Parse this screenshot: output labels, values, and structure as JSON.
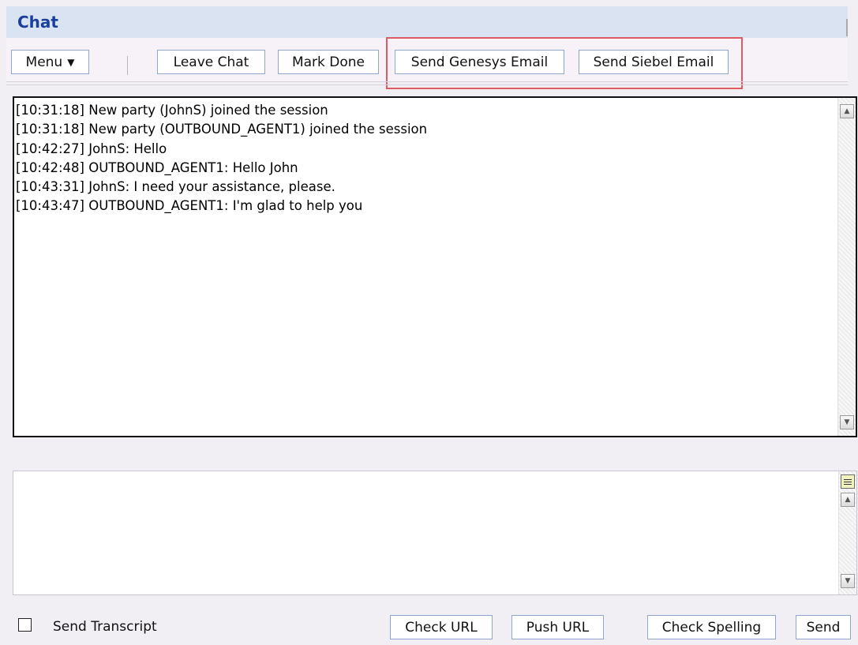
{
  "window": {
    "title": "Chat"
  },
  "toolbar": {
    "menu_label": "Menu",
    "menu_caret_icon": "caret-down-icon",
    "leave_chat_label": "Leave Chat",
    "mark_done_label": "Mark Done",
    "send_genesys_email_label": "Send Genesys Email",
    "send_siebel_email_label": "Send Siebel Email",
    "highlight_color": "#e05a64"
  },
  "transcript": {
    "lines": [
      "[10:31:18] New party (JohnS) joined the session",
      "[10:31:18] New party (OUTBOUND_AGENT1) joined the session",
      "[10:42:27] JohnS: Hello",
      "[10:42:48] OUTBOUND_AGENT1: Hello John",
      "[10:43:31] JohnS: I need your assistance, please.",
      "[10:43:47] OUTBOUND_AGENT1: I'm glad to help you"
    ],
    "scroll_up_icon": "scroll-up-icon",
    "scroll_down_icon": "scroll-down-icon"
  },
  "compose": {
    "value": "",
    "menu_icon": "standard-responses-icon"
  },
  "footer": {
    "send_transcript_label": "Send Transcript",
    "send_transcript_checked": false,
    "check_url_label": "Check URL",
    "push_url_label": "Push URL",
    "check_spelling_label": "Check Spelling",
    "send_label": "Send"
  },
  "colors": {
    "title_text": "#1b3f9c",
    "title_bar": "#d9e3f1",
    "button_border": "#8ea7cf",
    "background": "#f1eef4"
  }
}
